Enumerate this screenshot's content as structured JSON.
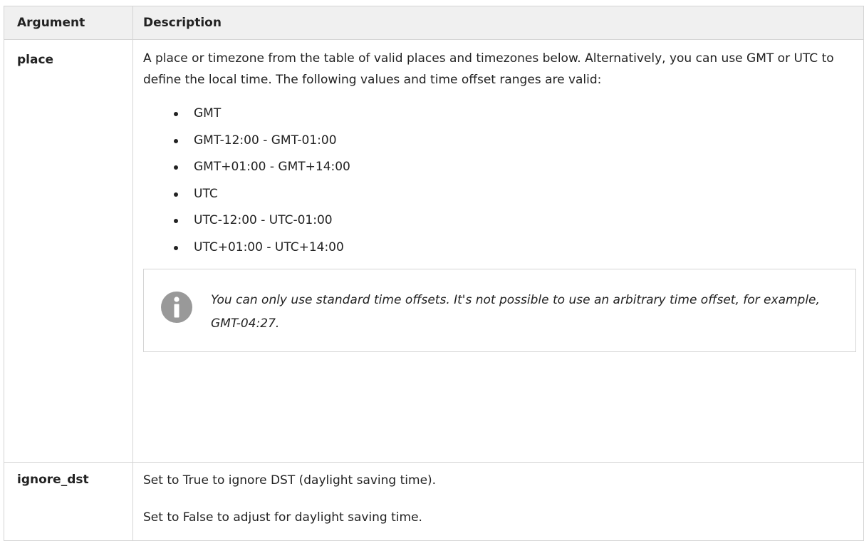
{
  "headers": {
    "argument": "Argument",
    "description": "Description"
  },
  "rows": {
    "place": {
      "name": "place",
      "description": "A place or timezone from the table of valid places and timezones below. Alternatively, you can use GMT or UTC to define the local time. The following values and time offset ranges are valid:",
      "values": [
        "GMT",
        "GMT-12:00 - GMT-01:00",
        "GMT+01:00 - GMT+14:00",
        "UTC",
        "UTC-12:00 - UTC-01:00",
        "UTC+01:00 - UTC+14:00"
      ],
      "note": "You can only use standard time offsets. It's not possible to use an arbitrary time offset, for example, GMT-04:27.",
      "note_icon": "info-icon"
    },
    "ignore_dst": {
      "name": "ignore_dst",
      "lines": [
        "Set to True to ignore DST (daylight saving time).",
        "Set to False to adjust for daylight saving time."
      ]
    }
  },
  "colors": {
    "header_bg": "#f0f0f0",
    "border": "#d4d4d4",
    "icon": "#999999"
  }
}
